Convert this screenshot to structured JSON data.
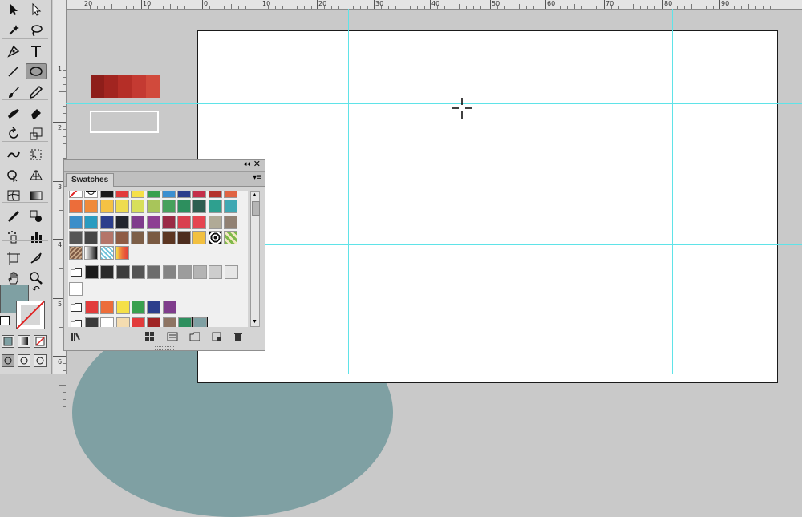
{
  "rulers": {
    "horizontal_labels": [
      "20",
      "10",
      "0",
      "10",
      "20",
      "30",
      "40",
      "50",
      "60",
      "70",
      "80",
      "90"
    ],
    "vertical_labels": [
      "1",
      "2",
      "3",
      "4",
      "5",
      "6"
    ]
  },
  "tools": [
    {
      "name": "selection-tool-icon"
    },
    {
      "name": "direct-selection-tool-icon"
    },
    {
      "name": "magic-wand-tool-icon"
    },
    {
      "name": "lasso-tool-icon"
    },
    {
      "name": "pen-tool-icon"
    },
    {
      "name": "type-tool-icon"
    },
    {
      "name": "line-segment-tool-icon"
    },
    {
      "name": "ellipse-tool-icon"
    },
    {
      "name": "paintbrush-tool-icon"
    },
    {
      "name": "pencil-tool-icon"
    },
    {
      "name": "blob-brush-tool-icon"
    },
    {
      "name": "eraser-tool-icon"
    },
    {
      "name": "rotate-tool-icon"
    },
    {
      "name": "scale-tool-icon"
    },
    {
      "name": "warp-tool-icon"
    },
    {
      "name": "free-transform-tool-icon"
    },
    {
      "name": "shape-builder-tool-icon"
    },
    {
      "name": "perspective-grid-tool-icon"
    },
    {
      "name": "mesh-tool-icon"
    },
    {
      "name": "gradient-tool-icon"
    },
    {
      "name": "eyedropper-tool-icon"
    },
    {
      "name": "blend-tool-icon"
    },
    {
      "name": "symbol-sprayer-tool-icon"
    },
    {
      "name": "column-graph-tool-icon"
    },
    {
      "name": "artboard-tool-icon"
    },
    {
      "name": "slice-tool-icon"
    },
    {
      "name": "hand-tool-icon"
    },
    {
      "name": "zoom-tool-icon"
    }
  ],
  "colors": {
    "fill": "#7fa0a3",
    "stroke": "none",
    "guide": "#5fe3e8",
    "circle": "#7fa0a3"
  },
  "canvas": {
    "color_group": [
      "#8e1e1a",
      "#a22520",
      "#b52e27",
      "#c43a32",
      "#d14a3c"
    ]
  },
  "swatches_panel": {
    "title": "Swatches",
    "rows": [
      [
        "none",
        "registration",
        "#1a1a1a",
        "#e23b3b",
        "#f5e049",
        "#38a04e",
        "#3b8fd0",
        "#2c3e8c",
        "#c42f4a",
        "#b3312a",
        "#e06443"
      ],
      [
        "#ec6d3a",
        "#f08a3a",
        "#f5c244",
        "#eedc4f",
        "#d7df5a",
        "#a8c55a",
        "#46a15c",
        "#2d8f5e",
        "#2e5e50",
        "#2ea08f",
        "#3fa8b3"
      ],
      [
        "#3b8ec9",
        "#2a9bc0",
        "#2c3e8c",
        "#23262e",
        "#7f3c8c",
        "#8d3f93",
        "#9a2b45",
        "#d9404f",
        "#e54550",
        "#b0aa96",
        "#918173"
      ],
      [
        "#565656",
        "#454545",
        "#b47569",
        "#8e5c45",
        "#7d5f48",
        "#7a5a42",
        "#5c3622",
        "#4d2d1e",
        "#f2c040",
        "pattern-dots",
        "pattern-leaves"
      ],
      [
        "pattern-texture",
        "gradient-bw",
        "pattern-dots2",
        "gradient-rainbow"
      ]
    ],
    "gray_row": [
      "#1a1a1a",
      "#2a2a2a",
      "#3d3d3d",
      "#545454",
      "#6c6c6c",
      "#848484",
      "#9c9c9c",
      "#b4b4b4",
      "#cdcdcd",
      "#e6e6e6"
    ],
    "white_row": [
      "#ffffff"
    ],
    "bright_row": [
      "#e23b3b",
      "#ec6d3a",
      "#f5e049",
      "#38a04e",
      "#2c3e8c",
      "#7f3c8c"
    ],
    "custom_row": [
      "#3a3a3a",
      "#ffffff",
      "#f4dcb0",
      "#e23b3b",
      "#a02424",
      "#8e7463",
      "#2d8f5e",
      "#7fa0a3"
    ]
  }
}
